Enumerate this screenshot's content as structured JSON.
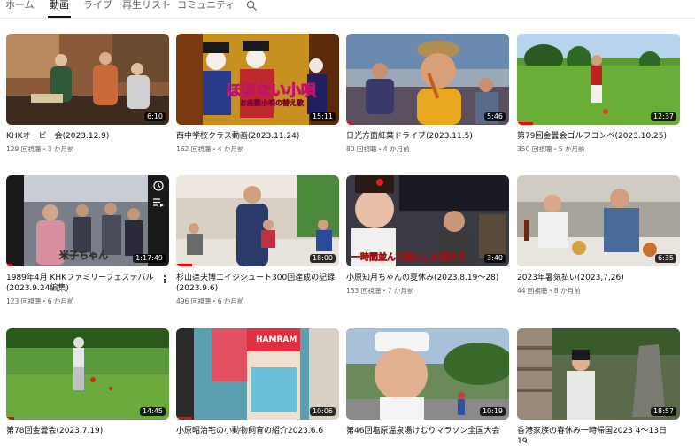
{
  "tabs": [
    {
      "label": "ホーム"
    },
    {
      "label": "動画"
    },
    {
      "label": "ライブ"
    },
    {
      "label": "再生リスト"
    },
    {
      "label": "コミュニティ"
    }
  ],
  "active_tab": "動画",
  "search_icon": "search-icon",
  "videos": [
    {
      "title": "KHKオービー会(2023.12.9)",
      "meta": "129 回視聴・3 か月前",
      "duration": "6:10",
      "progress": 0
    },
    {
      "title": "西中学校クラス動画(2023.11.24)",
      "meta": "162 回視聴・4 か月前",
      "duration": "15:11",
      "progress": 0,
      "overlay1": "ほぼない小唄",
      "overlay2": "お座敷小唄の替え歌"
    },
    {
      "title": "日光方面紅葉ドライブ(2023.11.5)",
      "meta": "80 回視聴・4 か月前",
      "duration": "5:46",
      "progress": 0.04
    },
    {
      "title": "第79回金曇会ゴルフコンペ(2023.10.25)",
      "meta": "350 回視聴・5 か月前",
      "duration": "12:37",
      "progress": 0.1
    },
    {
      "title": "1989年4月 KHKファミリーフェステバル (2023.9.24編集)",
      "meta": "123 回視聴・6 か月前",
      "duration": "1:17:49",
      "progress": 0.04,
      "overlay1": "米子ちゃん"
    },
    {
      "title": "杉山達夫博エイジシュート300回達成の記録 (2023.9.6)",
      "meta": "496 回視聴・6 か月前",
      "duration": "18:00",
      "progress": 0.1
    },
    {
      "title": "小原知月ちゃんの夏休み(2023.8.19〜28)",
      "meta": "133 回視聴・7 か月前",
      "duration": "3:40",
      "progress": 0,
      "overlay1": "一時間並んで購入した焼きそ"
    },
    {
      "title": "2023年暑気払い(2023,7,26)",
      "meta": "44 回視聴・8 か月前",
      "duration": "6:35",
      "progress": 0
    },
    {
      "title": "第78回金曇会(2023.7.19)",
      "meta": "",
      "duration": "14:45",
      "progress": 0.05
    },
    {
      "title": "小原昭治宅の小動物飼育の紹介2023.6.6",
      "meta": "",
      "duration": "10:06",
      "progress": 0.1,
      "overlay1": "HAMRAM"
    },
    {
      "title": "第46回塩原温泉湯けむりマラソン全国大会",
      "meta": "",
      "duration": "10:19",
      "progress": 0
    },
    {
      "title": "香港家族の春休み一時帰国2023 4〜13日19",
      "meta": "",
      "duration": "18:57",
      "progress": 0
    }
  ]
}
